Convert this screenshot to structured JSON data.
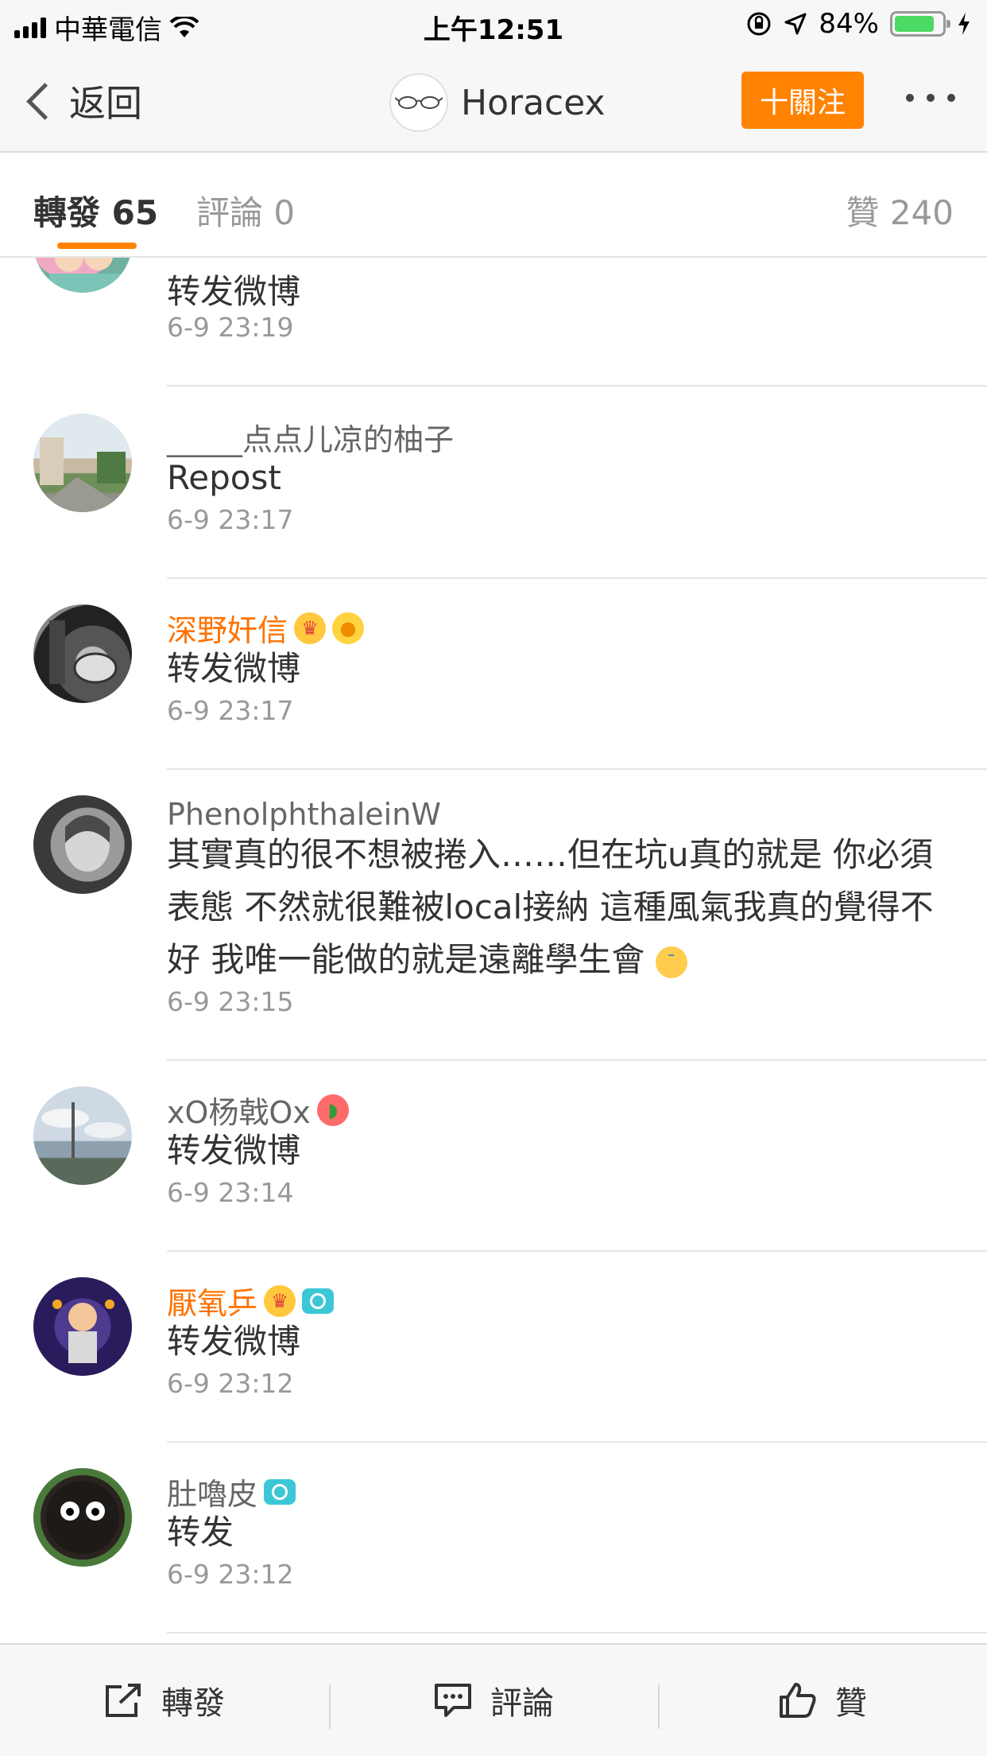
{
  "status": {
    "carrier": "中華電信",
    "time": "上午12:51",
    "battery": "84%",
    "battery_level": 0.84
  },
  "nav": {
    "back_label": "返回",
    "title": "Horacex",
    "follow_label": "十關注"
  },
  "tabs": {
    "repost": "轉發 65",
    "comment": "評論 0",
    "like": "贊 240"
  },
  "items": [
    {
      "name": "",
      "content": "转发微博",
      "date": "6-9 23:19"
    },
    {
      "name": "_____点点儿凉的柚子",
      "content": "Repost",
      "date": "6-9 23:17"
    },
    {
      "name": "深野奸信",
      "content": "转发微博",
      "date": "6-9 23:17"
    },
    {
      "name": "PhenolphthaleinW",
      "content": "其實真的很不想被捲入……但在坑u真的就是 你必須表態 不然就很難被local接納 這種風氣我真的覺得不好 我唯一能做的就是遠離學生會",
      "date": "6-9 23:15"
    },
    {
      "name": "xO杨戟Ox",
      "content": "转发微博",
      "date": "6-9 23:14"
    },
    {
      "name": "厭氧乒",
      "content": "转发微博",
      "date": "6-9 23:12"
    },
    {
      "name": "肚嚕皮",
      "content": "转发",
      "date": "6-9 23:12"
    }
  ],
  "bottom": {
    "repost": "轉發",
    "comment": "評論",
    "like": "贊"
  },
  "colors": {
    "accent": "#ff8200",
    "vip_name": "#ff7200",
    "secondary_text": "#999999"
  }
}
